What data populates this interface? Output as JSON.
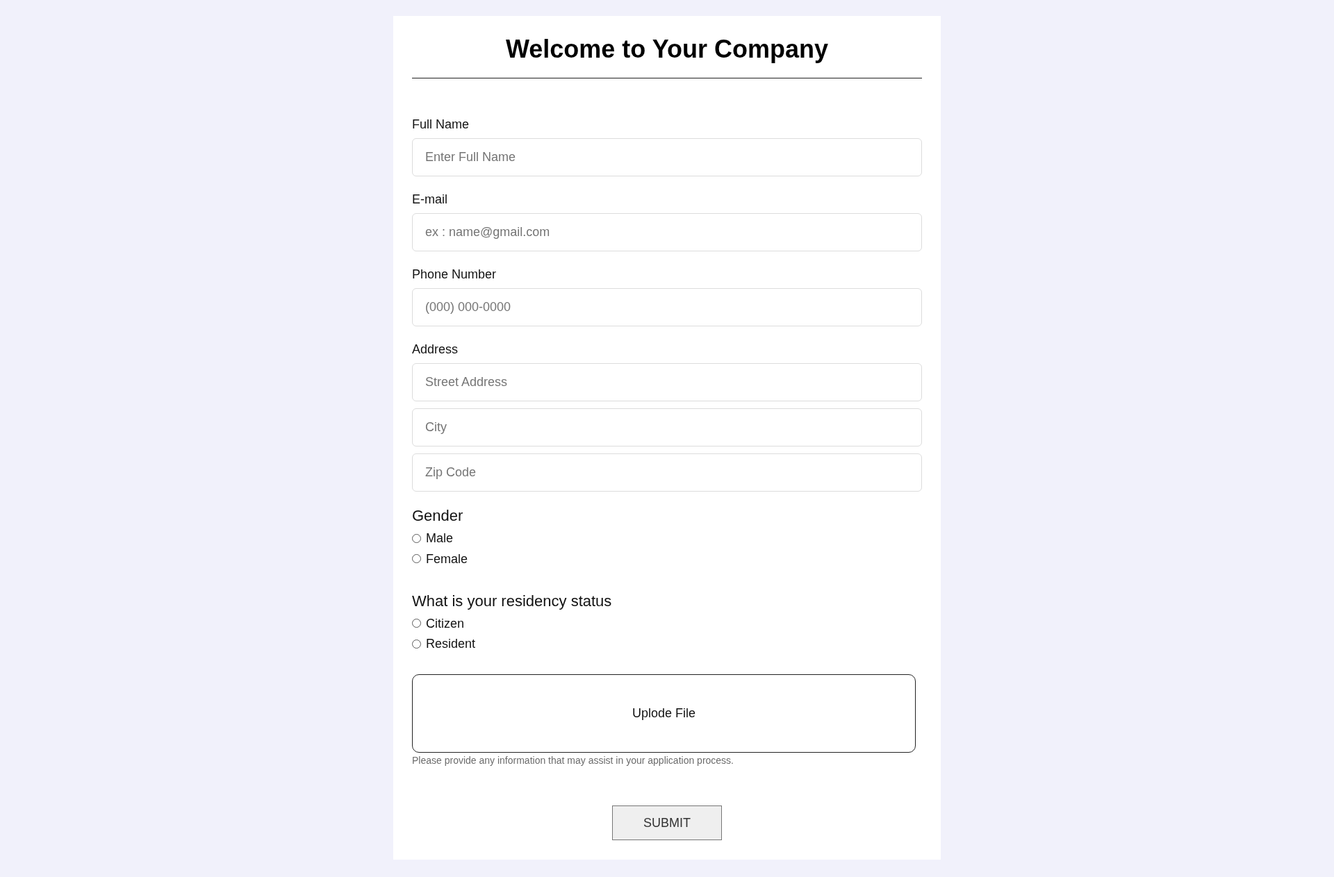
{
  "form": {
    "title": "Welcome to Your Company",
    "fields": [
      {
        "label": "Full Name",
        "inputs": [
          {
            "placeholder": "Enter Full Name"
          }
        ]
      },
      {
        "label": "E-mail",
        "inputs": [
          {
            "placeholder": "ex : name@gmail.com"
          }
        ]
      },
      {
        "label": "Phone Number",
        "inputs": [
          {
            "placeholder": "(000) 000-0000"
          }
        ]
      },
      {
        "label": "Address",
        "inputs": [
          {
            "placeholder": "Street Address"
          },
          {
            "placeholder": "City"
          },
          {
            "placeholder": "Zip Code"
          }
        ]
      }
    ],
    "radio_groups": [
      {
        "question": "Gender",
        "options": [
          {
            "label": "Male",
            "selected": false
          },
          {
            "label": "Female",
            "selected": false
          }
        ]
      },
      {
        "question": "What is your residency status",
        "options": [
          {
            "label": "Citizen",
            "selected": false
          },
          {
            "label": "Resident",
            "selected": false
          }
        ]
      }
    ],
    "upload": {
      "label": "Uplode File",
      "hint": "Please provide any information that may assist in your application process."
    },
    "submit": "SUBMIT"
  }
}
